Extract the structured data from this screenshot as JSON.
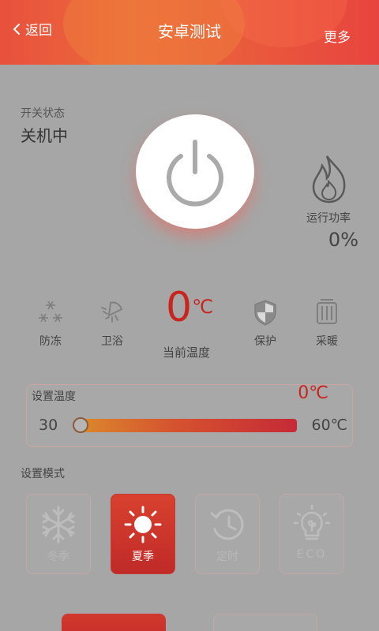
{
  "header": {
    "back_label": "返回",
    "title": "安卓测试",
    "more_label": "更多"
  },
  "status": {
    "label": "开关状态",
    "value": "关机中"
  },
  "power": {
    "label": "运行功率",
    "value": "0%"
  },
  "functions": [
    {
      "label": "防冻",
      "icon": "snowflakes-icon"
    },
    {
      "label": "卫浴",
      "icon": "shower-icon"
    },
    {
      "label": "保护",
      "icon": "shield-icon"
    },
    {
      "label": "采暖",
      "icon": "radiator-icon"
    }
  ],
  "current_temp": {
    "value": "0",
    "unit": "℃",
    "label": "当前温度"
  },
  "set_temp": {
    "title": "设置温度",
    "value": "0℃",
    "min": "30",
    "max": "60℃",
    "slider_fraction": 0
  },
  "mode": {
    "label": "设置模式",
    "items": [
      {
        "label": "冬季",
        "icon": "snowflake-icon",
        "active": false
      },
      {
        "label": "夏季",
        "icon": "sun-icon",
        "active": true
      },
      {
        "label": "定时",
        "icon": "timer-icon",
        "active": false
      },
      {
        "label": "ECO",
        "icon": "eco-bulb-icon",
        "active": false
      }
    ]
  },
  "colors": {
    "accent": "#c8251f",
    "header": "#e8513d"
  }
}
